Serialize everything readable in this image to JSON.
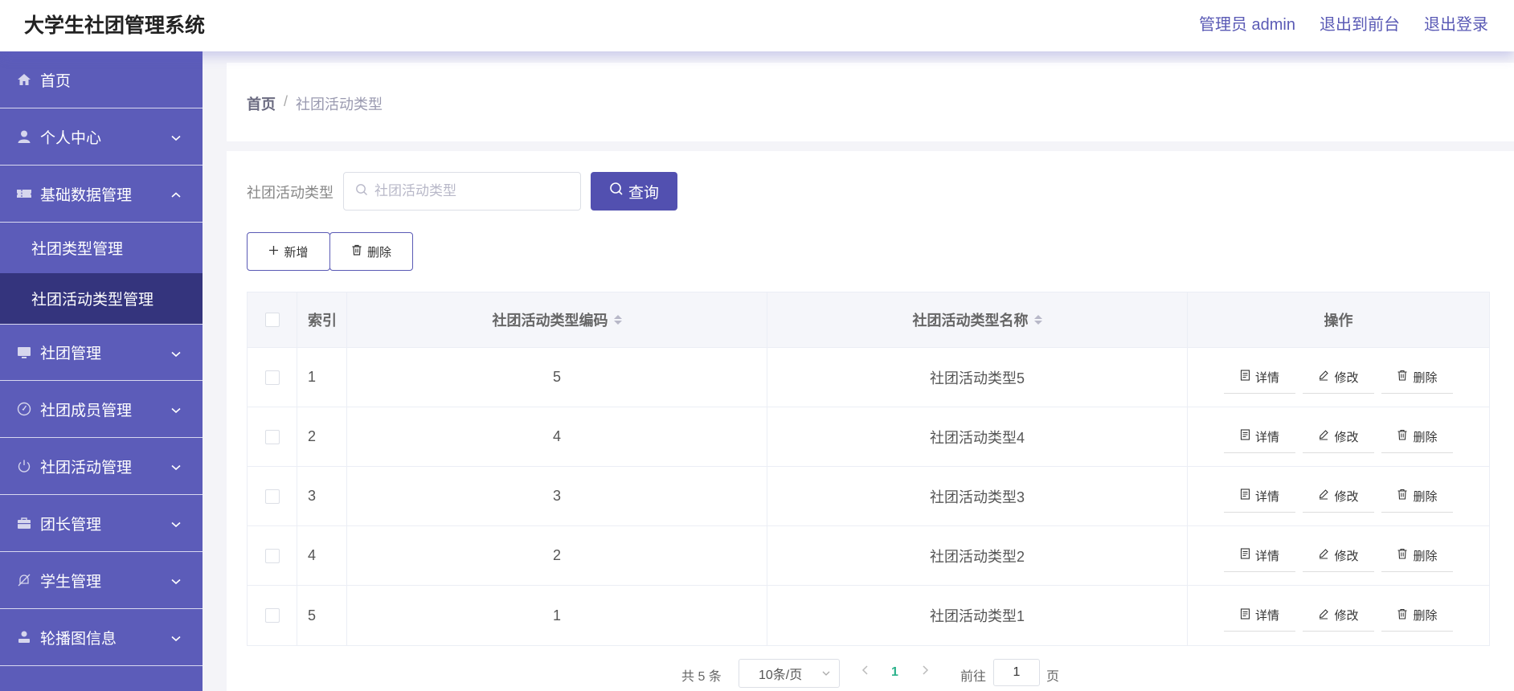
{
  "header": {
    "title": "大学生社团管理系统",
    "links": [
      "管理员 admin",
      "退出到前台",
      "退出登录"
    ]
  },
  "sidebar": {
    "items": [
      {
        "label": "首页",
        "icon": "home-icon",
        "expanded": null
      },
      {
        "label": "个人中心",
        "icon": "user-icon",
        "expanded": false
      },
      {
        "label": "基础数据管理",
        "icon": "ticket-icon",
        "expanded": true,
        "children": [
          {
            "label": "社团类型管理",
            "active": false
          },
          {
            "label": "社团活动类型管理",
            "active": true
          }
        ]
      },
      {
        "label": "社团管理",
        "icon": "monitor-icon",
        "expanded": false
      },
      {
        "label": "社团成员管理",
        "icon": "compass-icon",
        "expanded": false
      },
      {
        "label": "社团活动管理",
        "icon": "power-icon",
        "expanded": false
      },
      {
        "label": "团长管理",
        "icon": "briefcase-icon",
        "expanded": false
      },
      {
        "label": "学生管理",
        "icon": "bell-off-icon",
        "expanded": false
      },
      {
        "label": "轮播图信息",
        "icon": "user-solid-icon",
        "expanded": false
      }
    ]
  },
  "breadcrumb": {
    "home": "首页",
    "separator": "/",
    "current": "社团活动类型"
  },
  "search": {
    "label": "社团活动类型",
    "placeholder": "社团活动类型",
    "value": "",
    "button": "查询"
  },
  "actions": {
    "add": "新增",
    "delete": "删除"
  },
  "table": {
    "headers": {
      "index": "索引",
      "code": "社团活动类型编码",
      "name": "社团活动类型名称",
      "ops": "操作"
    },
    "op_labels": {
      "detail": "详情",
      "edit": "修改",
      "delete": "删除"
    },
    "rows": [
      {
        "index": "1",
        "code": "5",
        "name": "社团活动类型5"
      },
      {
        "index": "2",
        "code": "4",
        "name": "社团活动类型4"
      },
      {
        "index": "3",
        "code": "3",
        "name": "社团活动类型3"
      },
      {
        "index": "4",
        "code": "2",
        "name": "社团活动类型2"
      },
      {
        "index": "5",
        "code": "1",
        "name": "社团活动类型1"
      }
    ]
  },
  "pagination": {
    "total": "共 5 条",
    "page_size": "10条/页",
    "current_page": "1",
    "goto_prefix": "前往",
    "goto_value": "1",
    "goto_suffix": "页"
  },
  "colors": {
    "primary": "#5250b0",
    "sidebar": "#5c5cb9",
    "sidebar_active": "#34347d",
    "page_active": "#2bb28b"
  }
}
